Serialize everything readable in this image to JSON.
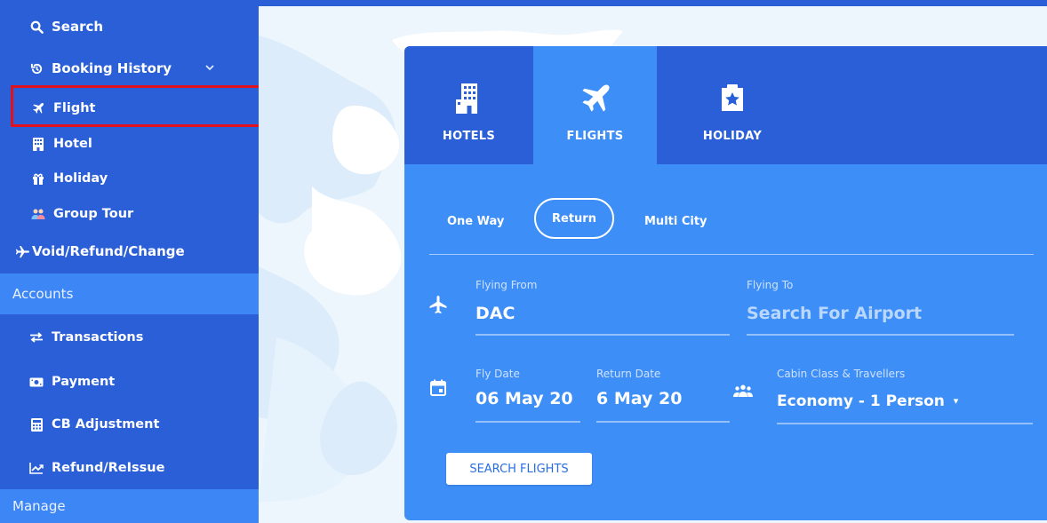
{
  "sidebar": {
    "items": [
      {
        "label": "Search",
        "icon": "search-icon"
      },
      {
        "label": "Booking History",
        "icon": "history-icon",
        "expanded": true
      },
      {
        "label": "Flight",
        "icon": "airplane-icon"
      },
      {
        "label": "Hotel",
        "icon": "building-icon"
      },
      {
        "label": "Holiday",
        "icon": "gift-icon"
      },
      {
        "label": "Group Tour",
        "icon": "people-icon"
      },
      {
        "label": "Void/Refund/Change",
        "icon": "plane-icon"
      }
    ],
    "accounts_header": "Accounts",
    "account_items": [
      {
        "label": "Transactions",
        "icon": "swap-arrows-icon"
      },
      {
        "label": "Payment",
        "icon": "money-icon"
      },
      {
        "label": "CB Adjustment",
        "icon": "calculator-icon"
      },
      {
        "label": "Refund/ReIssue",
        "icon": "trending-chart-icon"
      }
    ],
    "manage_header": "Manage",
    "highlight_color": "#e0111a"
  },
  "tabs": [
    {
      "label": "HOTELS",
      "icon": "hotel-building-icon",
      "active": false
    },
    {
      "label": "FLIGHTS",
      "icon": "airplane-icon",
      "active": true
    },
    {
      "label": "HOLIDAY",
      "icon": "holiday-badge-icon",
      "active": false
    }
  ],
  "trip_types": {
    "one_way": "One Way",
    "return": "Return",
    "multi_city": "Multi City",
    "selected": "Return"
  },
  "form": {
    "flying_from_label": "Flying From",
    "flying_from_value": "DAC",
    "flying_to_label": "Flying To",
    "flying_to_placeholder": "Search For Airport",
    "fly_date_label": "Fly Date",
    "fly_date_value": "06 May 20",
    "return_date_label": "Return Date",
    "return_date_value": "6 May 20",
    "cabin_label": "Cabin Class & Travellers",
    "cabin_value": "Economy - 1 Person"
  },
  "search_button": "SEARCH FLIGHTS",
  "colors": {
    "sidebar": "#2a5fd8",
    "sidebar_header": "#3d86f5",
    "panel": "#3d8ef7",
    "panel_tabs": "#2a5fd8",
    "button_text": "#2a6de0"
  }
}
